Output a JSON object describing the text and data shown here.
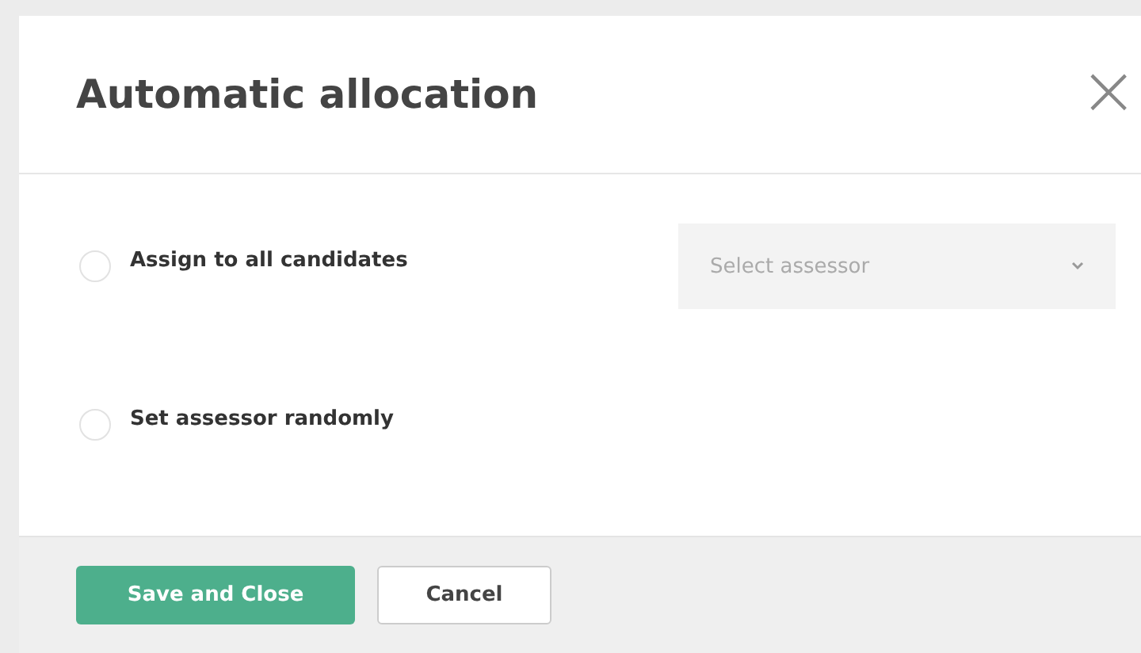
{
  "dialog": {
    "title": "Automatic allocation",
    "close": "×"
  },
  "options": [
    {
      "label": "Assign to all candidates",
      "selected": false,
      "select": {
        "placeholder": "Select assessor"
      }
    },
    {
      "label": "Set assessor randomly",
      "selected": false
    }
  ],
  "buttons": [
    {
      "label": "Save and Close",
      "kind": "primary"
    },
    {
      "label": "Cancel",
      "kind": "secondary"
    }
  ]
}
